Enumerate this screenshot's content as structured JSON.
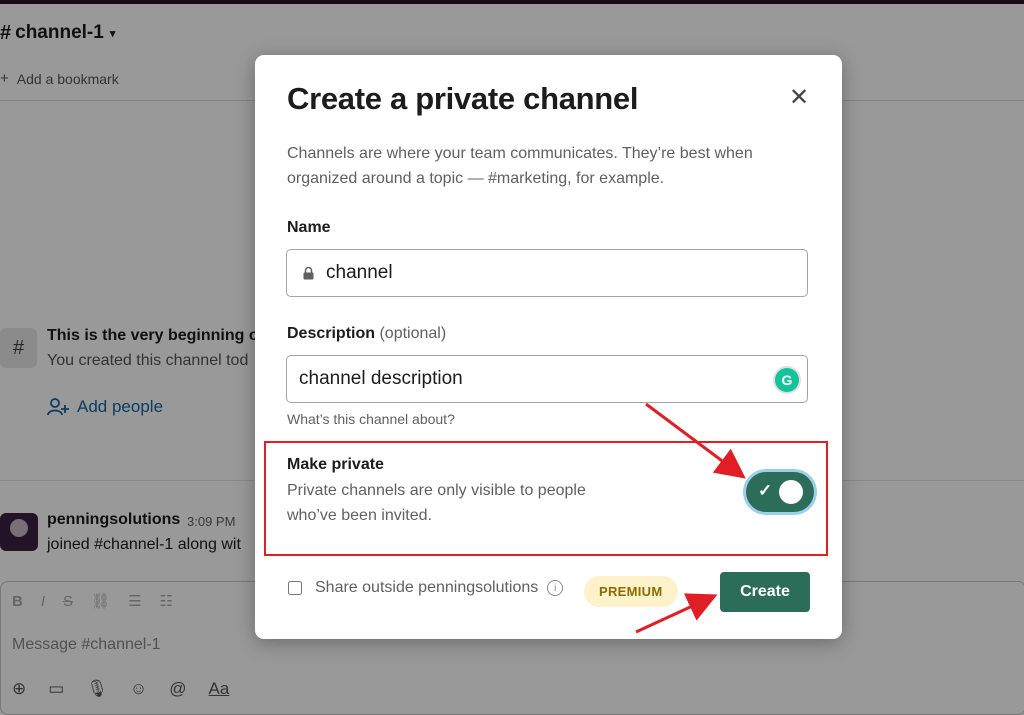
{
  "channel": {
    "hash": "#",
    "name": "channel-1",
    "bookmark_label": "Add a bookmark",
    "intro_title": "This is the very beginning of",
    "intro_sub": "You created this channel tod",
    "add_people": "Add people"
  },
  "message": {
    "author": "penningsolutions",
    "time": "3:09 PM",
    "text": "joined #channel-1 along wit"
  },
  "composer": {
    "placeholder": "Message #channel-1",
    "format_tools": [
      "B",
      "I",
      "S"
    ],
    "aa_label": "Aa"
  },
  "modal": {
    "title": "Create a private channel",
    "description": "Channels are where your team communicates. They’re best when organized around a topic — #marketing, for example.",
    "name_label": "Name",
    "name_value": "channel",
    "desc_label": "Description",
    "desc_optional": "(optional)",
    "desc_value": "channel description",
    "desc_hint": "What’s this channel about?",
    "private_title": "Make private",
    "private_sub": "Private channels are only visible to people who’ve been invited.",
    "private_enabled": true,
    "share_label": "Share outside penningsolutions",
    "premium_badge": "PREMIUM",
    "create_label": "Create",
    "close_icon": "close-icon"
  },
  "colors": {
    "accent_green": "#2b6d58",
    "highlight_red": "#e01e26",
    "link_blue": "#1264a3",
    "premium_bg": "#fdf2c9"
  }
}
